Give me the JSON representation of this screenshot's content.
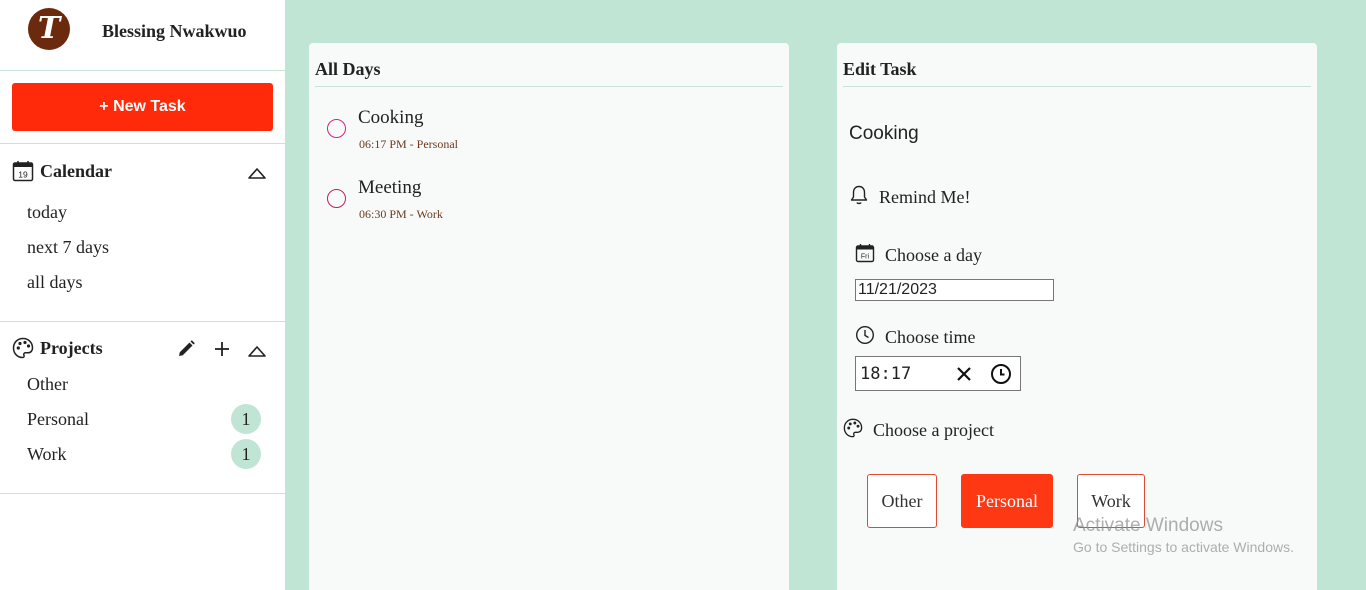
{
  "profile": {
    "initial": "T",
    "name": "Blessing Nwakwuo"
  },
  "sidebar": {
    "new_task_label": "+ New Task",
    "calendar": {
      "title": "Calendar",
      "icon_day": "19",
      "items": [
        "today",
        "next 7 days",
        "all days"
      ]
    },
    "projects": {
      "title": "Projects",
      "items": [
        {
          "label": "Other",
          "count": ""
        },
        {
          "label": "Personal",
          "count": "1"
        },
        {
          "label": "Work",
          "count": "1"
        }
      ]
    }
  },
  "all_days": {
    "title": "All Days",
    "tasks": [
      {
        "title": "Cooking",
        "meta": "06:17 PM - Personal"
      },
      {
        "title": "Meeting",
        "meta": "06:30 PM - Work"
      }
    ]
  },
  "edit_task": {
    "title": "Edit Task",
    "task_name": "Cooking",
    "remind_label": "Remind Me!",
    "day_label": "Choose a day",
    "day_icon": "Fri",
    "date_value": "11/21/2023",
    "time_label": "Choose time",
    "time_value": "18:17",
    "project_label": "Choose a project",
    "projects": [
      "Other",
      "Personal",
      "Work"
    ],
    "selected_project": "Personal"
  },
  "watermark": {
    "line1": "Activate Windows",
    "line2": "Go to Settings to activate Windows."
  },
  "colors": {
    "accent": "#ff2a0a",
    "mint": "#c1e5d5",
    "task_circle": "#d4237a"
  }
}
